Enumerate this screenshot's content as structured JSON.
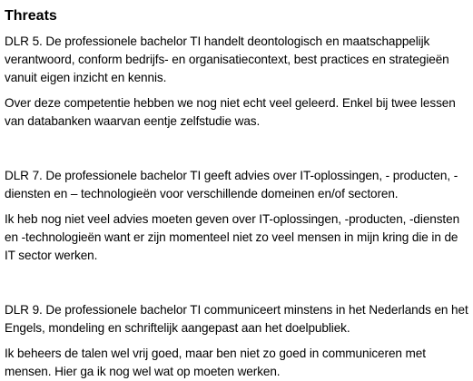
{
  "heading": "Threats",
  "sections": [
    {
      "lead": "DLR 5. De professionele bachelor TI handelt deontologisch en maatschappelijk verantwoord, conform bedrijfs- en organisatiecontext, best practices en strategieën vanuit eigen inzicht en kennis.",
      "body": "Over deze competentie hebben we nog niet echt veel geleerd. Enkel bij twee lessen van databanken waarvan eentje zelfstudie was."
    },
    {
      "lead": "DLR 7. De professionele bachelor TI geeft advies over IT-oplossingen, - producten, - diensten en – technologieën voor verschillende domeinen en/of sectoren.",
      "body": "Ik heb nog niet veel advies moeten geven over IT-oplossingen, -producten, -diensten en -technologieën want er zijn momenteel niet zo veel mensen in mijn kring die in de IT sector werken."
    },
    {
      "lead": "DLR 9. De professionele bachelor TI communiceert minstens in het Nederlands en het Engels, mondeling en schriftelijk aangepast aan het doelpubliek.",
      "body": "Ik beheers de talen wel vrij goed, maar ben niet zo goed in communiceren met mensen. Hier ga ik nog wel wat op moeten werken."
    }
  ]
}
